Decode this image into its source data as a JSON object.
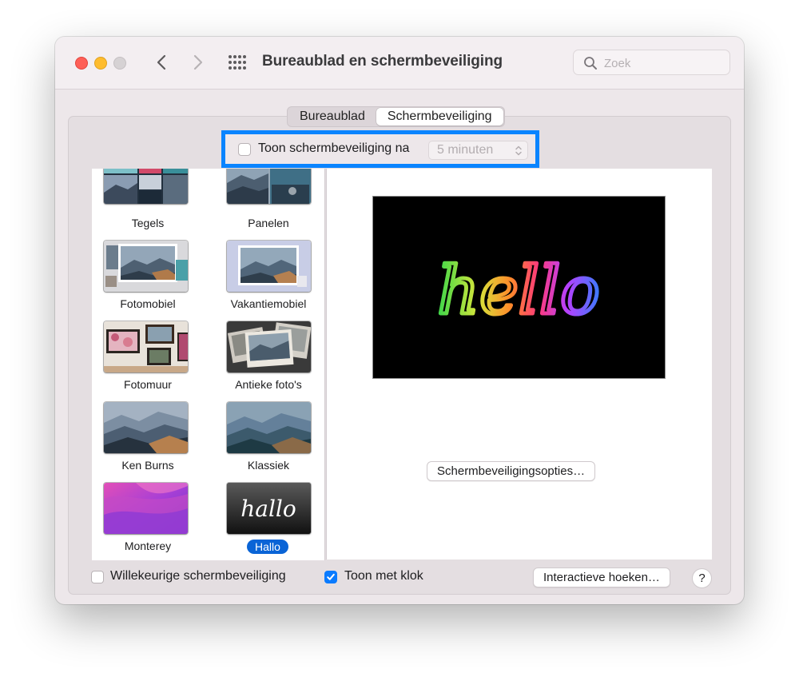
{
  "window": {
    "title": "Bureaublad en schermbeveiliging"
  },
  "search": {
    "placeholder": "Zoek"
  },
  "tabs": [
    {
      "label": "Bureaublad",
      "active": false
    },
    {
      "label": "Schermbeveiliging",
      "active": true
    }
  ],
  "show_after": {
    "label": "Toon schermbeveiliging na",
    "checked": false,
    "value": "5 minuten"
  },
  "screensavers": [
    {
      "label": "Tegels",
      "selected": false,
      "icon": "tiles-thumbnail"
    },
    {
      "label": "Panelen",
      "selected": false,
      "icon": "panels-thumbnail"
    },
    {
      "label": "Fotomobiel",
      "selected": false,
      "icon": "photo-mobile-thumbnail"
    },
    {
      "label": "Vakantiemobiel",
      "selected": false,
      "icon": "holiday-mobile-thumbnail"
    },
    {
      "label": "Fotomuur",
      "selected": false,
      "icon": "photo-wall-thumbnail"
    },
    {
      "label": "Antieke foto's",
      "selected": false,
      "icon": "vintage-prints-thumbnail"
    },
    {
      "label": "Ken Burns",
      "selected": false,
      "icon": "ken-burns-thumbnail"
    },
    {
      "label": "Klassiek",
      "selected": false,
      "icon": "classic-thumbnail"
    },
    {
      "label": "Monterey",
      "selected": false,
      "icon": "monterey-thumbnail"
    },
    {
      "label": "Hallo",
      "selected": true,
      "icon": "hello-thumbnail",
      "thumb_text": "hallo"
    }
  ],
  "preview": {
    "text": "hello"
  },
  "options_button": "Schermbeveiligingsopties…",
  "random": {
    "label": "Willekeurige schermbeveiliging",
    "checked": false
  },
  "clock": {
    "label": "Toon met klok",
    "checked": true
  },
  "hot_corners_button": "Interactieve hoeken…",
  "help_button": "?",
  "colors": {
    "accent": "#0a84ff",
    "selection": "#0a64d6",
    "red": "#fe5f57",
    "yellow": "#febc2e"
  }
}
